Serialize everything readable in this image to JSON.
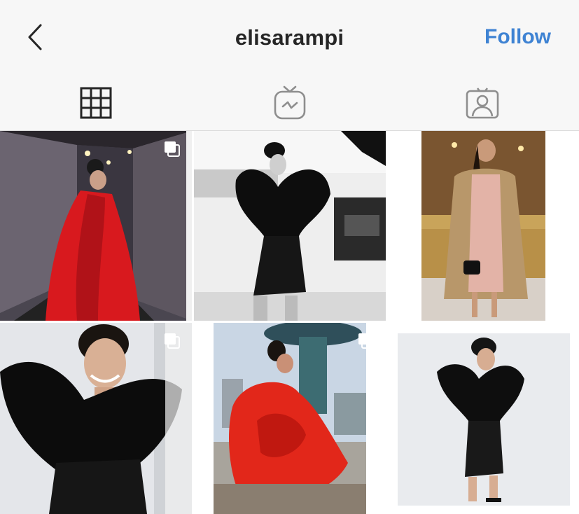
{
  "header": {
    "back_icon": "chevron-left-icon",
    "username": "elisarampi",
    "follow_label": "Follow",
    "follow_color": "#3f83d3"
  },
  "tabs": [
    {
      "id": "grid",
      "icon": "grid-icon",
      "active": true
    },
    {
      "id": "igtv",
      "icon": "igtv-icon",
      "active": false
    },
    {
      "id": "tagged",
      "icon": "tagged-person-icon",
      "active": false
    }
  ],
  "posts": [
    {
      "subject": "red cape gown in dark hallway",
      "multiple": true
    },
    {
      "subject": "black ruffled mini dress, black and white street",
      "multiple": false
    },
    {
      "subject": "fur coat and pink dress at balcony",
      "multiple": true
    },
    {
      "subject": "black ruffled dress portrait smiling",
      "multiple": true
    },
    {
      "subject": "red gown by fountain",
      "multiple": true
    },
    {
      "subject": "black ruffled dress studio pose",
      "multiple": false
    }
  ]
}
